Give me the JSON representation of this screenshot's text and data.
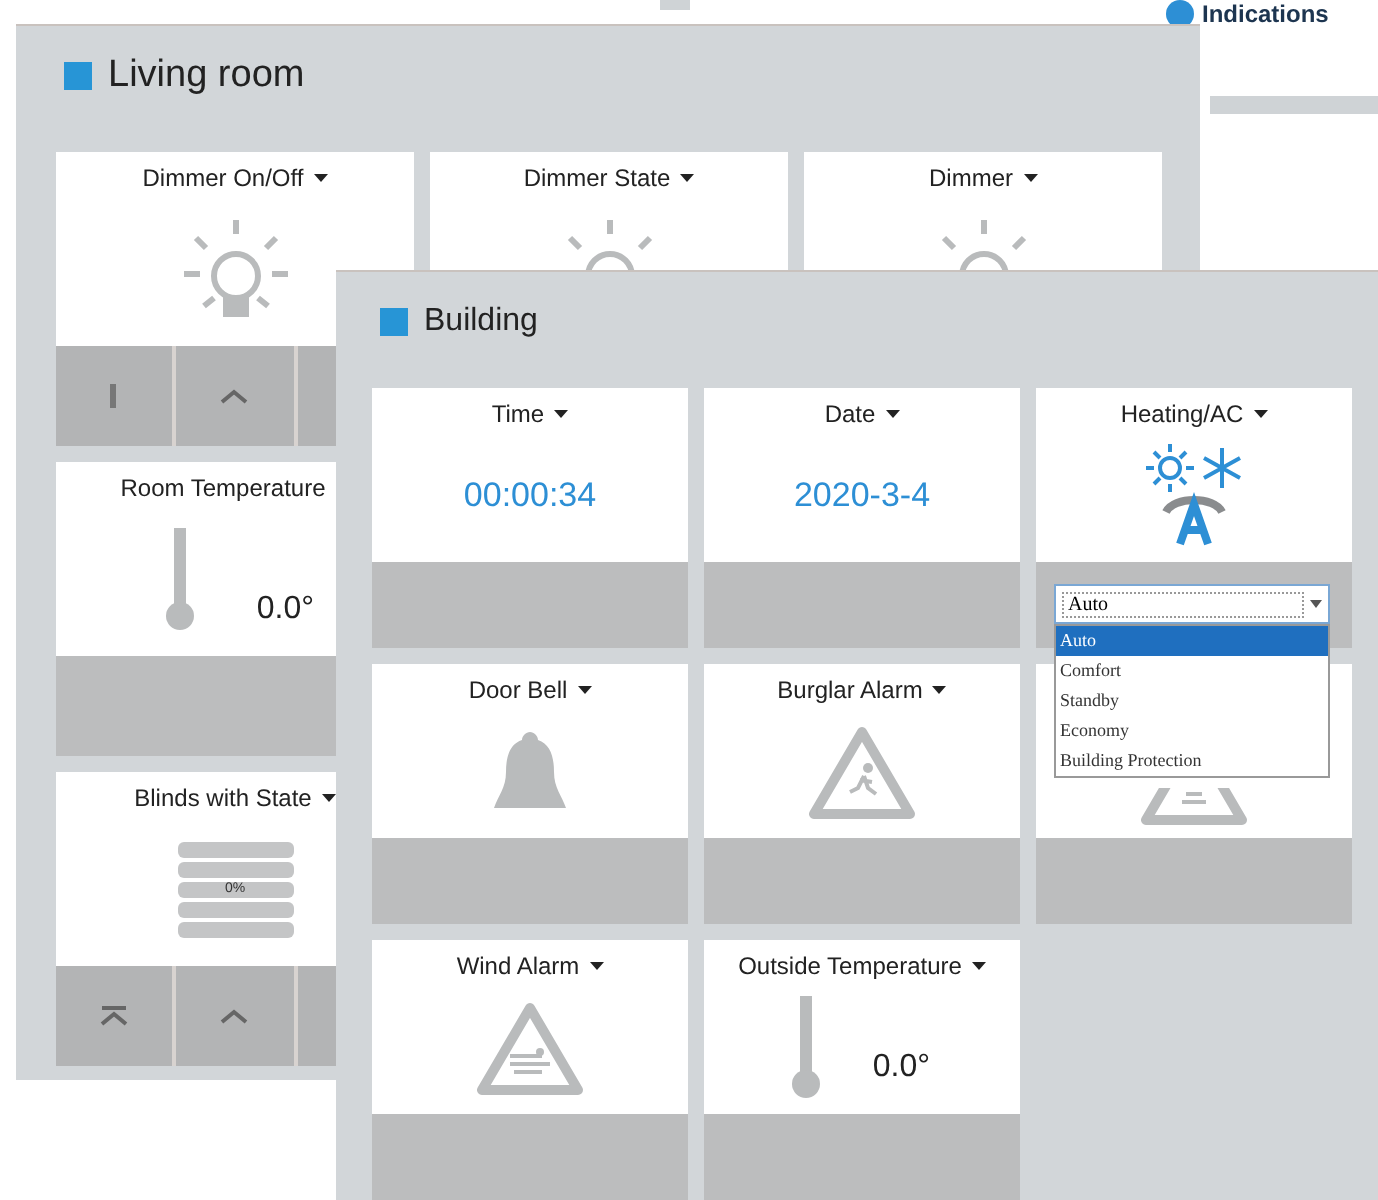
{
  "corner": {
    "label": "Indications"
  },
  "panels": [
    {
      "title": "Living room",
      "tiles": [
        {
          "title": "Dimmer On/Off",
          "kind": "light",
          "buttons": [
            {
              "kind": "on"
            },
            {
              "kind": "up"
            },
            {
              "kind": "plain"
            }
          ]
        },
        {
          "title": "Dimmer State",
          "kind": "light"
        },
        {
          "title": "Dimmer",
          "kind": "light"
        },
        {
          "title": "Room Temperature",
          "kind": "thermometer",
          "value": "0.0°"
        },
        {
          "kind": "blank"
        },
        {
          "kind": "blank"
        },
        {
          "title": "Blinds with State",
          "kind": "blinds",
          "value": "0%",
          "buttons": [
            {
              "kind": "top"
            },
            {
              "kind": "up"
            },
            {
              "kind": "plain"
            }
          ]
        }
      ]
    },
    {
      "title": "Building",
      "tiles": [
        {
          "title": "Time",
          "kind": "reading",
          "value": "00:00:34"
        },
        {
          "title": "Date",
          "kind": "reading",
          "value": "2020-3-4"
        },
        {
          "title": "Heating/AC",
          "kind": "mode",
          "select": {
            "value": "Auto",
            "expanded": true,
            "options": [
              {
                "label": "Auto",
                "selected": true
              },
              {
                "label": "Comfort",
                "selected": false
              },
              {
                "label": "Standby",
                "selected": false
              },
              {
                "label": "Economy",
                "selected": false
              },
              {
                "label": "Building Protection",
                "selected": false
              }
            ]
          }
        },
        {
          "title": "Door Bell",
          "kind": "bell"
        },
        {
          "title": "Burglar Alarm",
          "kind": "burglar"
        },
        {
          "kind": "alarm"
        },
        {
          "title": "Wind Alarm",
          "kind": "wind"
        },
        {
          "title": "Outside Temperature",
          "kind": "thermometer",
          "value": "0.0°"
        }
      ]
    }
  ]
}
